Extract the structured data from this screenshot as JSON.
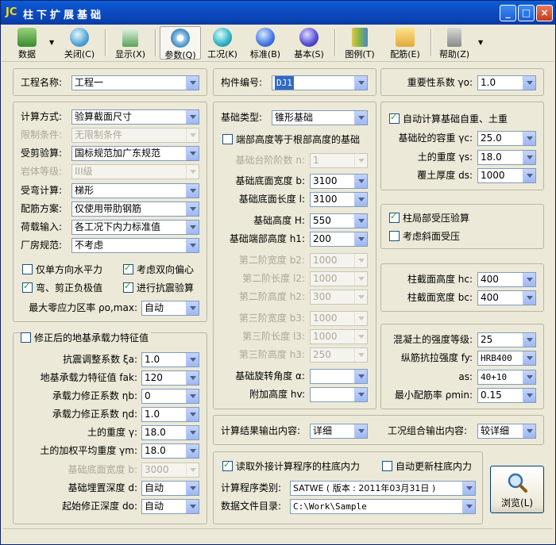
{
  "window": {
    "logo": "JC",
    "title": "柱下扩展基础",
    "btn_min": "_",
    "btn_max": "□",
    "btn_close": "×"
  },
  "toolbar": {
    "data": "数据",
    "close": "关闭(C)",
    "display": "显示(X)",
    "param": "参数(Q)",
    "condition": "工况(K)",
    "std": "标准(B)",
    "basic": "基本(S)",
    "legend": "图例(T)",
    "rebar": "配筋(E)",
    "help": "帮助(Z)"
  },
  "top": {
    "project_label": "工程名称:",
    "project_value": "工程一",
    "member_label": "构件编号:",
    "member_value": "DJ1",
    "importance_label": "重要性系数 γo:",
    "importance_value": "1.0"
  },
  "calc": {
    "method_label": "计算方式:",
    "method_value": "验算截面尺寸",
    "limit_label": "限制条件:",
    "limit_value": "无限制条件",
    "punch_label": "受剪验算:",
    "punch_value": "国标规范加广东规范",
    "rock_label": "岩体等级:",
    "rock_value": "III级",
    "bend_label": "受弯计算:",
    "bend_value": "梯形",
    "rebar_label": "配筋方案:",
    "rebar_value": "仅使用带肋钢筋",
    "load_label": "荷载输入:",
    "load_value": "各工况下内力标准值",
    "plant_label": "厂房规范:",
    "plant_value": "不考虑",
    "chk_single": "仅单方向水平力",
    "chk_biaxial": "考虑双向偏心",
    "chk_negative": "弯、剪正负极值",
    "chk_seismic": "进行抗震验算",
    "zero_label": "最大零应力区率 ρo,max:",
    "zero_value": "自动"
  },
  "bearing": {
    "title": "修正后的地基承载力特征值",
    "xi_label": "抗震调整系数 ξa:",
    "xi_value": "1.0",
    "fak_label": "地基承载力特征值 fak:",
    "fak_value": "120",
    "nb_label": "承载力修正系数 ηb:",
    "nb_value": "0",
    "nd_label": "承载力修正系数 ηd:",
    "nd_value": "1.0",
    "gamma_label": "土的重度 γ:",
    "gamma_value": "18.0",
    "gm_label": "土的加权平均重度 γm:",
    "gm_value": "18.0",
    "width_label": "基础底面宽度 b:",
    "width_value": "3000",
    "depth_label": "基础埋置深度 d:",
    "depth_value": "自动",
    "d0_label": "起始修正深度 do:",
    "d0_value": "自动"
  },
  "foundation": {
    "type_label": "基础类型:",
    "type_value": "锥形基础",
    "chk_edge": "端部高度等于根部高度的基础",
    "steps_label": "基础台阶阶数 n:",
    "steps_value": "1",
    "b_label": "基础底面宽度 b:",
    "b_value": "3100",
    "l_label": "基础底面长度 l:",
    "l_value": "3100",
    "h_label": "基础高度 H:",
    "h_value": "550",
    "h1_label": "基础端部高度 h1:",
    "h1_value": "200",
    "b2_label": "第二阶宽度 b2:",
    "b2_value": "1000",
    "l2_label": "第二阶长度 l2:",
    "l2_value": "1000",
    "h2_label": "第二阶高度 h2:",
    "h2_value": "300",
    "b3_label": "第三阶宽度 b3:",
    "b3_value": "1000",
    "l3_label": "第三阶长度 l3:",
    "l3_value": "1000",
    "h3_label": "第三阶高度 h3:",
    "h3_value": "250",
    "angle_label": "基础旋转角度 α:",
    "angle_value": "",
    "hv_label": "附加高度 hv:",
    "hv_value": ""
  },
  "soil": {
    "chk_auto": "自动计算基础自重、土重",
    "gc_label": "基础砼的容重 γc:",
    "gc_value": "25.0",
    "gs_label": "土的重度 γs:",
    "gs_value": "18.0",
    "ds_label": "覆土厚度 ds:",
    "ds_value": "1000"
  },
  "local": {
    "chk_local": "柱局部受压验算",
    "chk_slope": "考虑斜面受压"
  },
  "column": {
    "hc_label": "柱截面高度 hc:",
    "hc_value": "400",
    "bc_label": "柱截面宽度 bc:",
    "bc_value": "400"
  },
  "material": {
    "concrete_label": "混凝土的强度等级:",
    "concrete_value": "25",
    "fy_label": "纵筋抗拉强度 fy:",
    "fy_value": "HRB400",
    "as_label": "as:",
    "as_value": "40+10",
    "pmin_label": "最小配筋率 ρmin:",
    "pmin_value": "0.15"
  },
  "output": {
    "content_label": "计算结果输出内容:",
    "content_value": "详细",
    "combo_label": "工况组合输出内容:",
    "combo_value": "较详细"
  },
  "external": {
    "chk_read": "读取外接计算程序的柱底内力",
    "chk_update": "自动更新柱底内力",
    "program_label": "计算程序类别:",
    "program_value": "SATWE ( 版本 : 2011年03月31日 )",
    "dir_label": "数据文件目录:",
    "dir_value": "C:\\Work\\Sample",
    "browse": "浏览(L)"
  }
}
